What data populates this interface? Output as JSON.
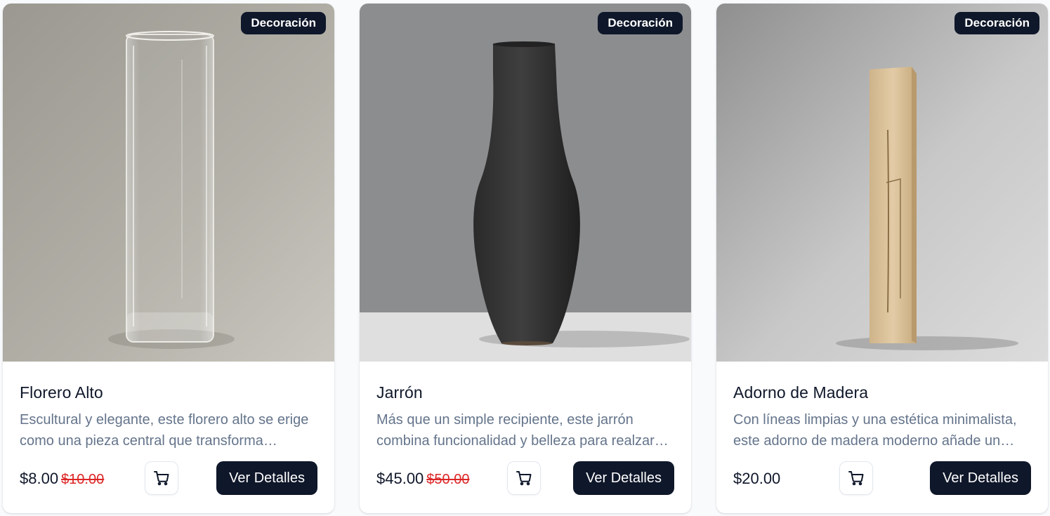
{
  "products": [
    {
      "badge": "Decoración",
      "title": "Florero Alto",
      "description": "Escultural y elegante, este florero alto se erige como una pieza central que transforma cualquier espacio con su presencia.",
      "price": "$8.00",
      "old_price": "$10.00",
      "details_label": "Ver Detalles",
      "cart_icon": "shopping-cart-icon"
    },
    {
      "badge": "Decoración",
      "title": "Jarrón",
      "description": "Más que un simple recipiente, este jarrón combina funcionalidad y belleza para realzar cualquier rincón del hogar.",
      "price": "$45.00",
      "old_price": "$50.00",
      "details_label": "Ver Detalles",
      "cart_icon": "shopping-cart-icon"
    },
    {
      "badge": "Decoración",
      "title": "Adorno de Madera",
      "description": "Con líneas limpias y una estética minimalista, este adorno de madera moderno añade un toque natural a tu espacio.",
      "price": "$20.00",
      "old_price": "",
      "details_label": "Ver Detalles",
      "cart_icon": "shopping-cart-icon"
    }
  ],
  "colors": {
    "primary": "#0f172a",
    "muted_text": "#64748b",
    "sale_red": "#dc2626",
    "page_bg": "#f8fafc"
  }
}
